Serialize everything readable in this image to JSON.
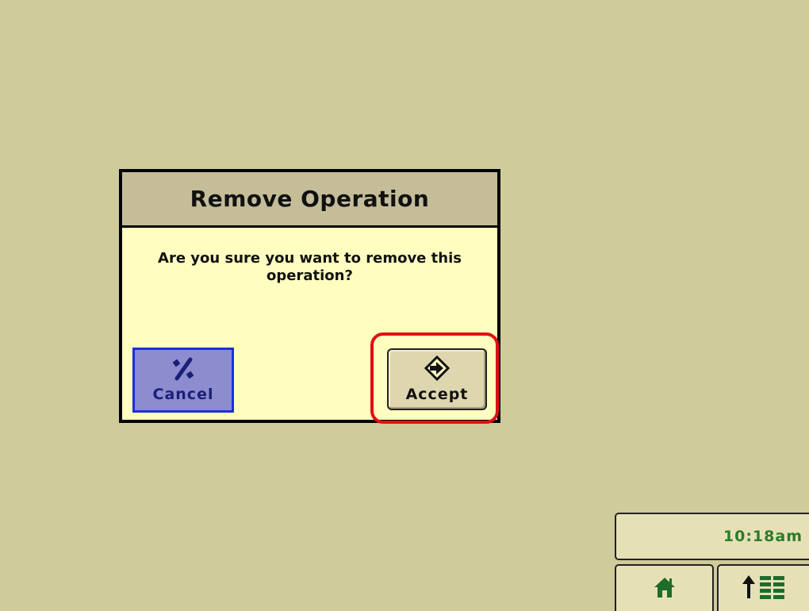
{
  "dialog": {
    "title": "Remove Operation",
    "message": "Are you sure you want to remove this operation?",
    "cancel_label": "Cancel",
    "accept_label": "Accept"
  },
  "status": {
    "time": "10:18am"
  },
  "icons": {
    "cancel": "cancel-percent-icon",
    "accept": "accept-arrow-diamond-icon",
    "home": "home-icon",
    "menu": "menu-up-arrow-icon"
  },
  "colors": {
    "background": "#cfcb9b",
    "dialog_body": "#fffec0",
    "dialog_header": "#c4bd98",
    "cancel_fill": "#8c8cce",
    "cancel_border": "#1a2fe0",
    "highlight": "#e01010",
    "clock_text": "#2f7a2a"
  }
}
